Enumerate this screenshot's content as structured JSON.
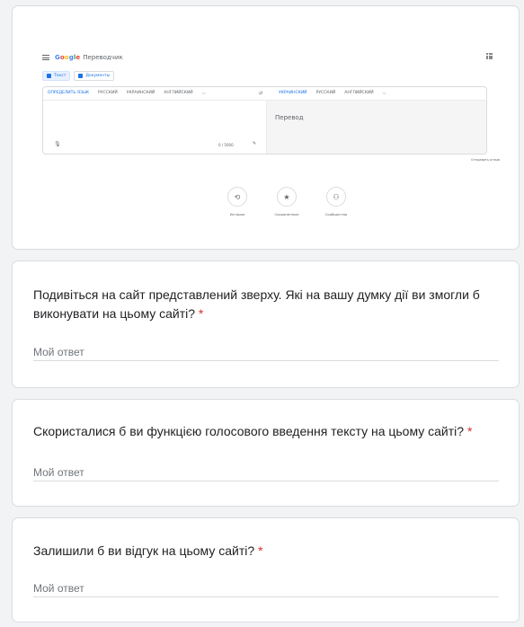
{
  "translate_screenshot": {
    "logo": [
      "G",
      "o",
      "o",
      "g",
      "l",
      "e"
    ],
    "product": "Переводчик",
    "modes": [
      {
        "label": "Текст",
        "active": true
      },
      {
        "label": "Документы",
        "active": false
      }
    ],
    "source_langs": [
      "ОПРЕДЕЛИТЬ ЯЗЫК",
      "РУССКИЙ",
      "УКРАИНСКИЙ",
      "АНГЛИЙСКИЙ"
    ],
    "target_langs": [
      "УКРАИНСКИЙ",
      "РУССКИЙ",
      "АНГЛИЙСКИЙ"
    ],
    "translation_placeholder": "Перевод",
    "char_count": "0 / 5000",
    "feedback_link": "Отправить отзыв",
    "actions": [
      {
        "icon": "history-icon",
        "label": "История"
      },
      {
        "icon": "star-icon",
        "label": "Сохраненные"
      },
      {
        "icon": "community-icon",
        "label": "Сообщество"
      }
    ]
  },
  "questions": [
    {
      "title": "Подивіться на сайт представлений зверху. Які на вашу думку дії ви змогли б виконувати на цьому сайті?",
      "required_mark": "*",
      "placeholder": "Мой ответ"
    },
    {
      "title": "Скористалися б ви функцією голосового введення тексту на цьому сайті?",
      "required_mark": "*",
      "placeholder": "Мой ответ"
    },
    {
      "title": "Залишили б ви відгук на цьому сайті?",
      "required_mark": "*",
      "placeholder": "Мой ответ"
    }
  ],
  "colors": {
    "background": "#f1f3f4",
    "card": "#ffffff",
    "required": "#d93025",
    "accent": "#1a73e8"
  }
}
